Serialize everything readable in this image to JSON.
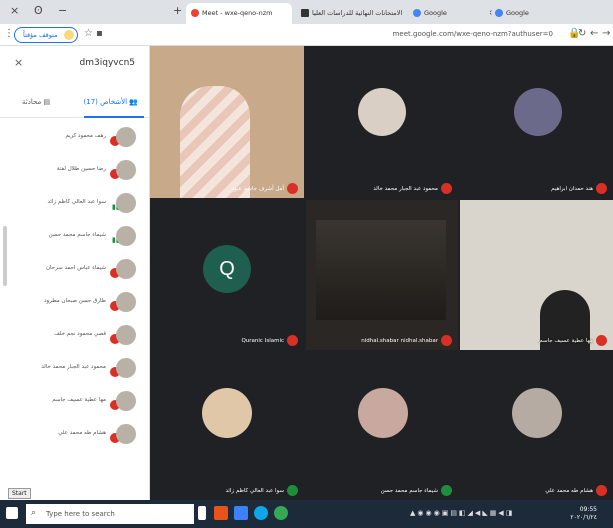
{
  "window": {
    "minimize": "−",
    "close": "×",
    "extra": "ʘ"
  },
  "tabs": [
    {
      "label": "Google",
      "icon": "google-icon"
    },
    {
      "label": "Google",
      "icon": "google-icon"
    },
    {
      "label": "الامتحانات النهائية للدراسات العليا",
      "icon": "bookmark-icon"
    },
    {
      "label": "Meet - wxe-qeno-nzm",
      "icon": "meet-icon"
    }
  ],
  "address": {
    "url": "meet.google.com/wxe-qeno-nzm?authuser=0",
    "profile_pill": "متوقف مؤقتاً"
  },
  "panel": {
    "meeting_name": "dm3iqyvcn5",
    "tab_people": "الأشخاص (17)",
    "tab_chat": "محادثة",
    "participants": [
      {
        "name": "رهف محمود كريم",
        "muted": true
      },
      {
        "name": "رضا حسين طلال لفتة",
        "muted": true
      },
      {
        "name": "سوا عبد العالي كاظم زائد",
        "muted": false
      },
      {
        "name": "شيماء جاسم محمد حسن",
        "muted": false
      },
      {
        "name": "شيماء عباس احمد سرحان",
        "muted": true
      },
      {
        "name": "طارق حسن صبحان مطرود",
        "muted": true
      },
      {
        "name": "قصي محمود نجم خلف",
        "muted": true
      },
      {
        "name": "محمود عبد الجبار محمد خالد",
        "muted": true
      },
      {
        "name": "مها عطية عسيف جاسم",
        "muted": true
      },
      {
        "name": "هشام طه محمد علي",
        "muted": true
      }
    ]
  },
  "tiles": [
    {
      "name": "أمل أشرف جاسم عبود"
    },
    {
      "name": "محمود عبد الجبار محمد خالد"
    },
    {
      "name": "هند حمدان ابراهيم"
    },
    {
      "name": "Quranic Islamic",
      "letter": "Q"
    },
    {
      "name": "nidhal.shabar nidhal.shabar"
    },
    {
      "name": "مها عطية عسيف جاسم"
    },
    {
      "name": "سوا عبد العالي كاظم زائد"
    },
    {
      "name": "شيماء جاسم محمد حسن"
    },
    {
      "name": "هشام طه محمد علي"
    }
  ],
  "taskbar": {
    "start_tip": "Start",
    "search_placeholder": "Type here to search",
    "time": "09:55",
    "date": "٢٠٢٠/٦/٢٤"
  }
}
